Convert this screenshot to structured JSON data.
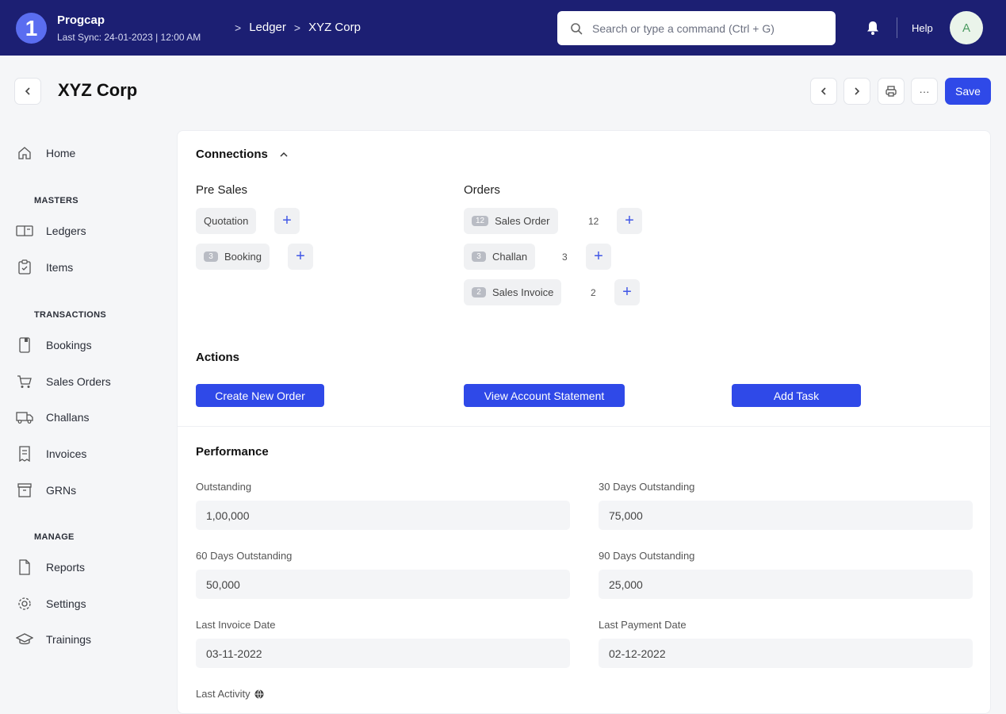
{
  "topbar": {
    "logo_char": "1",
    "brand": "Progcap",
    "last_sync": "Last Sync: 24-01-2023 | 12:00 AM",
    "breadcrumbs": [
      ">",
      "Ledger",
      ">",
      "XYZ Corp"
    ],
    "search_placeholder": "Search or type a command (Ctrl + G)",
    "help": "Help",
    "avatar_initial": "A"
  },
  "header": {
    "title": "XYZ Corp",
    "more_label": "···",
    "save_label": "Save"
  },
  "sidebar": {
    "home": "Home",
    "sections": [
      {
        "heading": "MASTERS",
        "items": [
          "Ledgers",
          "Items"
        ]
      },
      {
        "heading": "TRANSACTIONS",
        "items": [
          "Bookings",
          "Sales Orders",
          "Challans",
          "Invoices",
          "GRNs"
        ]
      },
      {
        "heading": "MANAGE",
        "items": [
          "Reports",
          "Settings",
          "Trainings"
        ]
      }
    ]
  },
  "connections": {
    "title": "Connections",
    "pre_sales": {
      "title": "Pre Sales",
      "items": [
        {
          "label": "Quotation",
          "badge": ""
        },
        {
          "label": "Booking",
          "badge": "3"
        }
      ]
    },
    "orders": {
      "title": "Orders",
      "items": [
        {
          "label": "Sales Order",
          "badge": "12",
          "count": "12"
        },
        {
          "label": "Challan",
          "badge": "3",
          "count": "3"
        },
        {
          "label": "Sales Invoice",
          "badge": "2",
          "count": "2"
        }
      ]
    },
    "plus": "+"
  },
  "actions": {
    "title": "Actions",
    "buttons": [
      "Create New Order",
      "View Account Statement",
      "Add Task"
    ]
  },
  "performance": {
    "title": "Performance",
    "fields": [
      {
        "label": "Outstanding",
        "value": "1,00,000"
      },
      {
        "label": "30 Days Outstanding",
        "value": "75,000"
      },
      {
        "label": "60 Days Outstanding",
        "value": "50,000"
      },
      {
        "label": "90 Days Outstanding",
        "value": "25,000"
      },
      {
        "label": "Last Invoice Date",
        "value": "03-11-2022"
      },
      {
        "label": "Last Payment Date",
        "value": "02-12-2022"
      }
    ],
    "last_activity": "Last Activity"
  }
}
